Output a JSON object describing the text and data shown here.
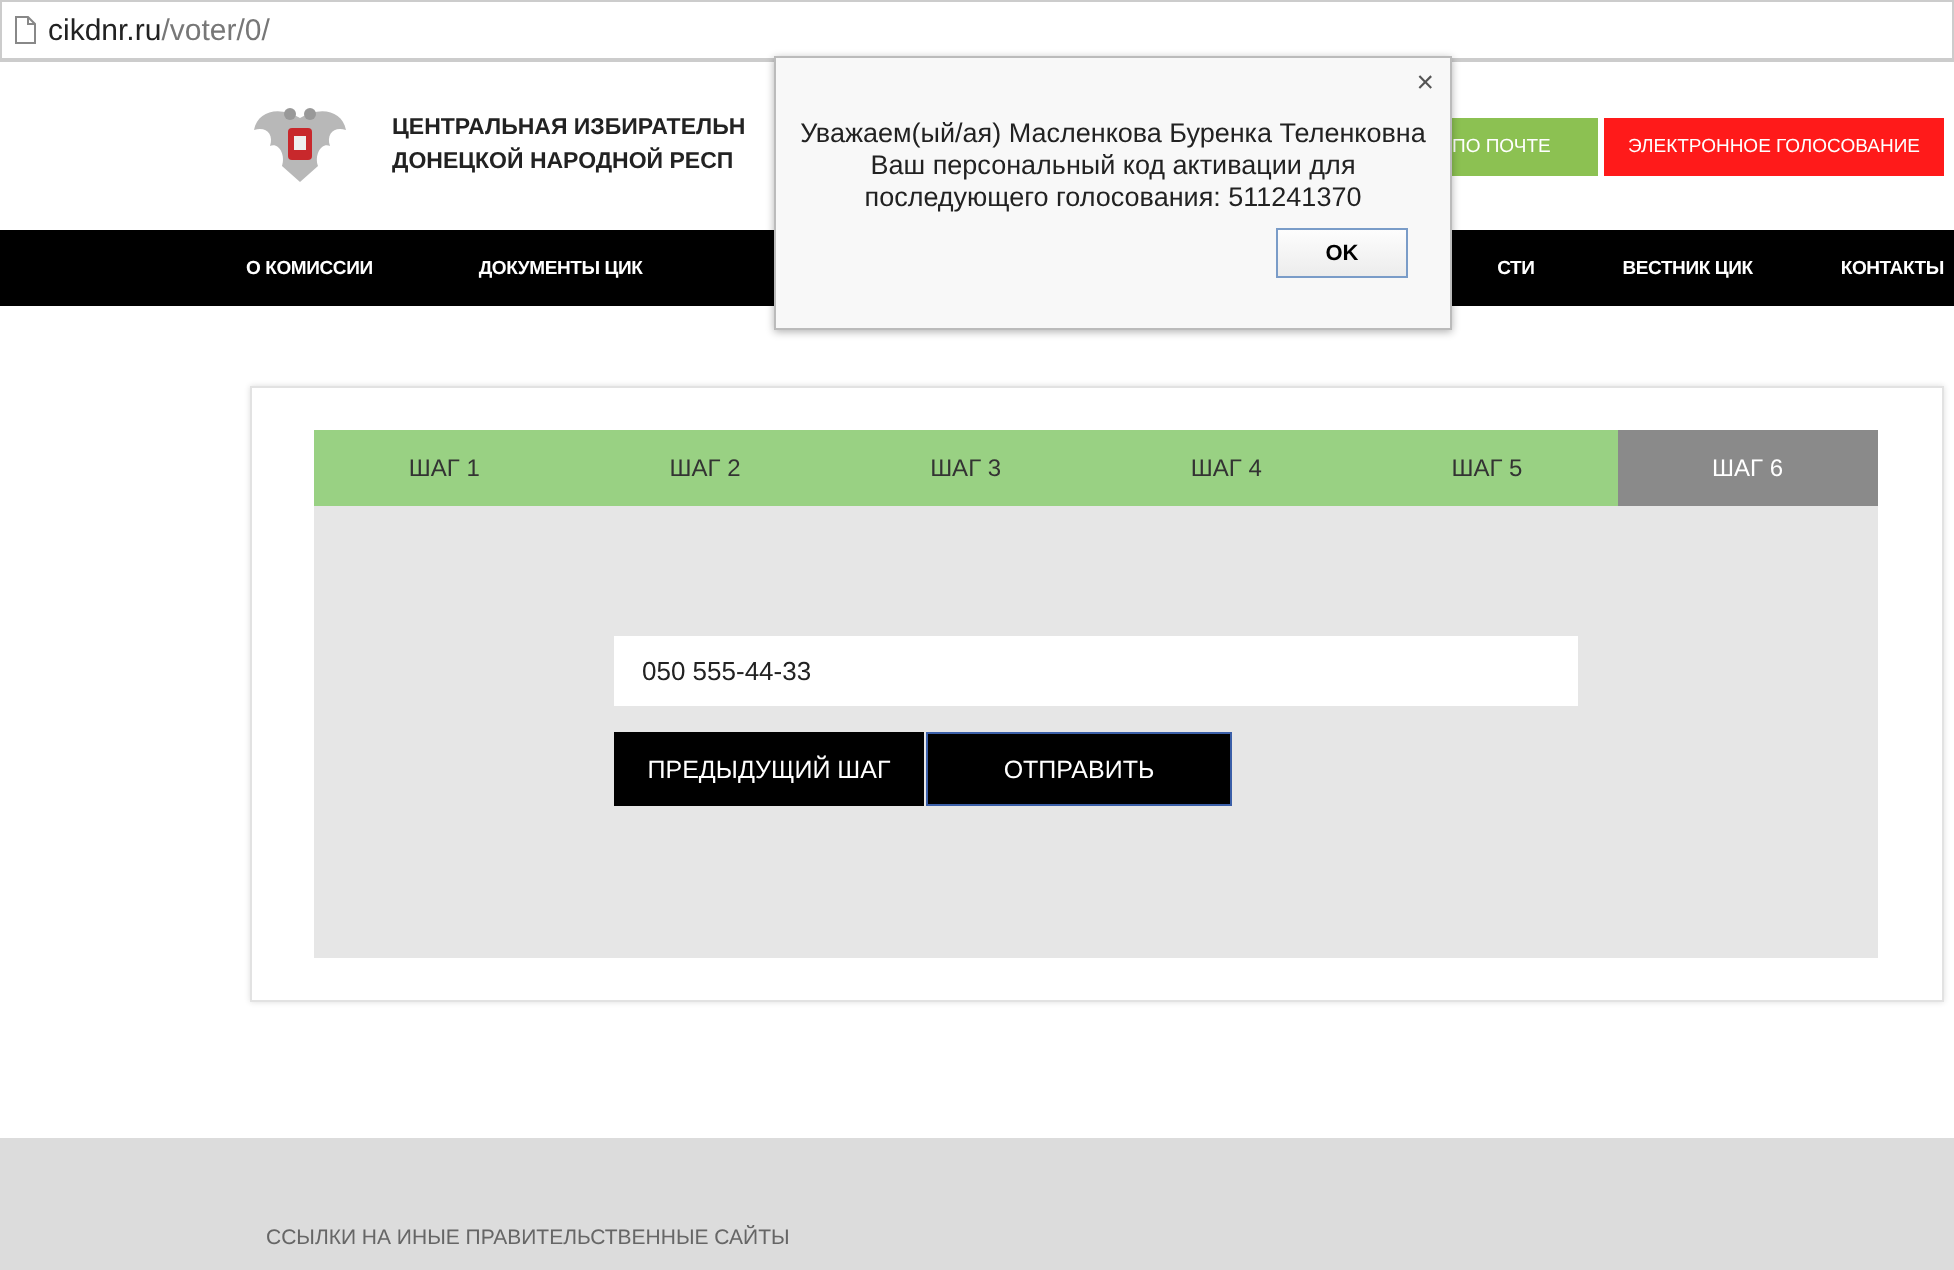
{
  "address_bar": {
    "domain": "cikdnr.ru",
    "path": "/voter/0/"
  },
  "header": {
    "title_lines": [
      "ЦЕНТРАЛЬНАЯ ИЗБИРАТЕЛЬН",
      "ДОНЕЦКОЙ НАРОДНОЙ РЕСП"
    ],
    "buttons": [
      {
        "label": "ПО ПОЧТЕ",
        "color": "#8cc152"
      },
      {
        "label": "ЭЛЕКТРОННОЕ ГОЛОСОВАНИЕ",
        "color": "#ff1a1a"
      }
    ]
  },
  "nav": {
    "left": [
      "О КОМИССИИ",
      "ДОКУМЕНТЫ ЦИК"
    ],
    "right": [
      "СТИ",
      "ВЕСТНИК ЦИК",
      "КОНТАКТЫ"
    ]
  },
  "steps": [
    {
      "label": "ШАГ 1",
      "selected": false
    },
    {
      "label": "ШАГ 2",
      "selected": false
    },
    {
      "label": "ШАГ 3",
      "selected": false
    },
    {
      "label": "ШАГ 4",
      "selected": false
    },
    {
      "label": "ШАГ 5",
      "selected": false
    },
    {
      "label": "ШАГ 6",
      "selected": true
    }
  ],
  "phone_field": {
    "value": "050 555-44-33"
  },
  "form_buttons": [
    {
      "label": "ПРЕДЫДУЩИЙ ШАГ",
      "kind": "back"
    },
    {
      "label": "ОТПРАВИТЬ",
      "kind": "submit"
    }
  ],
  "footer": {
    "heading": "ССЫЛКИ НА ИНЫЕ ПРАВИТЕЛЬСТВЕННЫЕ САЙТЫ"
  },
  "dialog": {
    "close": "×",
    "lines": [
      "Уважаем(ый/ая) Масленкова Буренка Теленковна",
      "Ваш персональный код активации для",
      "последующего голосования: 511241370"
    ],
    "button": "OK"
  }
}
